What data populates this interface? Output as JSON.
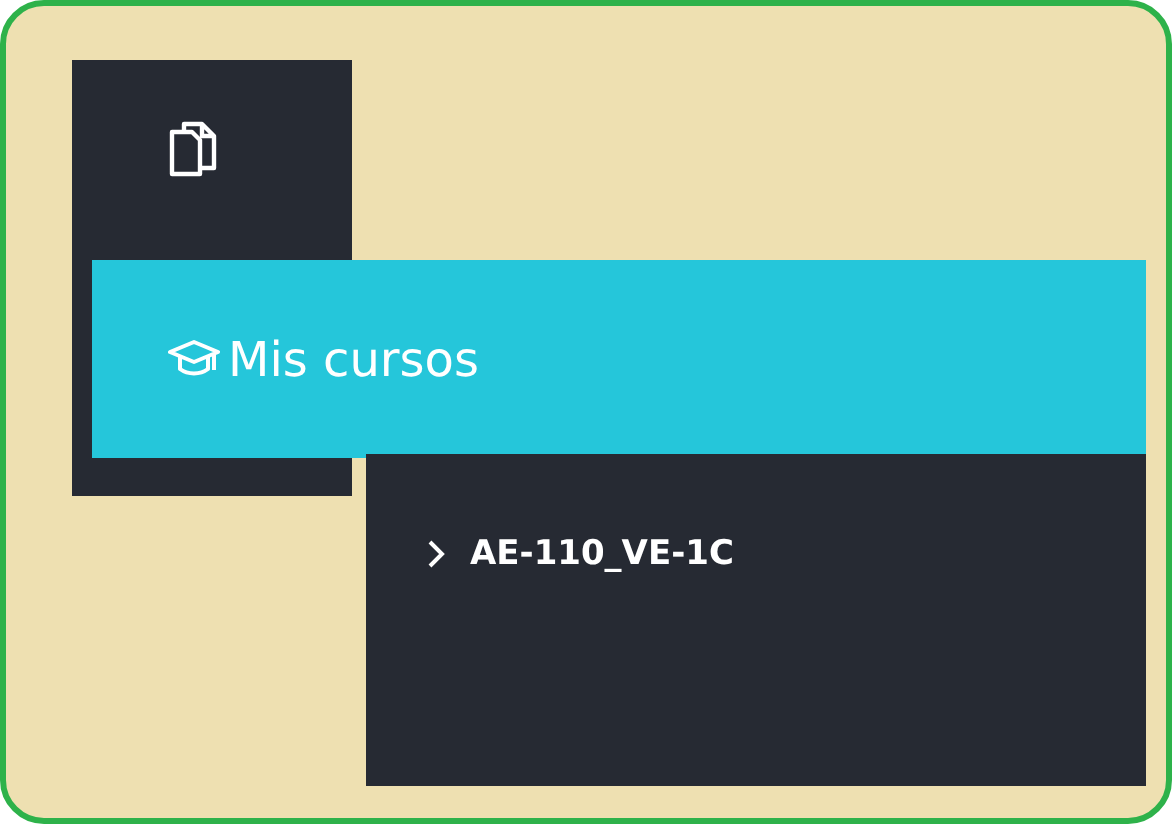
{
  "menu": {
    "title": "Mis cursos"
  },
  "courses": [
    {
      "label": "AE-110_VE-1C",
      "expanded": false
    }
  ]
}
